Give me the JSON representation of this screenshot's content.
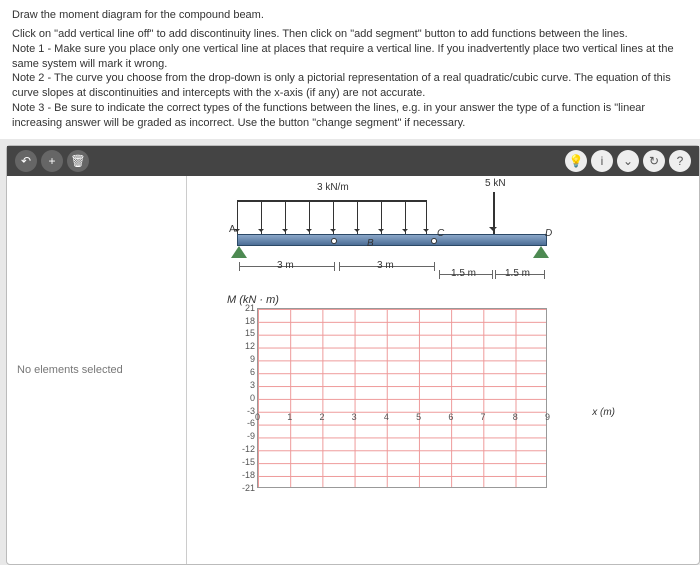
{
  "instructions": {
    "title": "Draw the moment diagram for the compound beam.",
    "line1": "Click on \"add vertical line off\" to add discontinuity lines. Then click on \"add segment\" button to add functions between the lines.",
    "note1": "Note 1 - Make sure you place only one vertical line at places that require a vertical line. If you inadvertently place two vertical lines at the same system will mark it wrong.",
    "note2": "Note 2 - The curve you choose from the drop-down is only a pictorial representation of a real quadratic/cubic curve. The equation of this curve slopes at discontinuities and intercepts with the x-axis (if any) are not accurate.",
    "note3": "Note 3 - Be sure to indicate the correct types of the functions between the lines, e.g. in your answer the type of a function is \"linear increasing answer will be graded as incorrect. Use the button \"change segment\" if necessary."
  },
  "toolbar": {
    "t1": "↶",
    "t2": "+",
    "t3": "🗑",
    "r1": "💡",
    "r2": "i",
    "r3": "⌄",
    "r4": "↻",
    "r5": "?"
  },
  "sidebar": {
    "msg": "No elements selected"
  },
  "beam": {
    "dist_load": "3 kN/m",
    "point_load": "5 kN",
    "ptA": "A",
    "ptB": "B",
    "ptC": "C",
    "ptD": "D",
    "dim1": "3 m",
    "dim2": "3 m",
    "dim3": "1.5 m",
    "dim4": "1.5 m"
  },
  "chart_data": {
    "type": "line",
    "title": "M (kN · m)",
    "xlabel": "x (m)",
    "ylabel": "",
    "y_ticks": [
      21,
      18,
      15,
      12,
      9,
      6,
      3,
      0,
      -3,
      -6,
      -9,
      -12,
      -15,
      -18,
      -21
    ],
    "x_ticks": [
      0,
      1,
      2,
      3,
      4,
      5,
      6,
      7,
      8,
      9
    ],
    "ylim": [
      -21,
      21
    ],
    "xlim": [
      0,
      9
    ],
    "series": []
  }
}
